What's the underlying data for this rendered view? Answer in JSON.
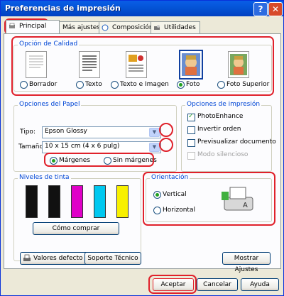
{
  "window": {
    "title": "Preferencias de impresión",
    "help_glyph": "?",
    "close_glyph": "✕"
  },
  "tabs": [
    {
      "label": "Principal",
      "icon": "printer-icon"
    },
    {
      "label": "Más ajustes",
      "icon": "options-icon"
    },
    {
      "label": "Composición",
      "icon": "layout-icon"
    },
    {
      "label": "Utilidades",
      "icon": "utilities-icon"
    }
  ],
  "quality": {
    "legend": "Opción de Calidad",
    "options": [
      {
        "label": "Borrador",
        "selected": false
      },
      {
        "label": "Texto",
        "selected": false
      },
      {
        "label": "Texto e Imagen",
        "selected": false
      },
      {
        "label": "Foto",
        "selected": true
      },
      {
        "label": "Foto Superior",
        "selected": false
      }
    ]
  },
  "paper": {
    "legend": "Opciones del Papel",
    "type_label": "Tipo:",
    "type_value": "Epson Glossy",
    "size_label": "Tamaño:",
    "size_value": "10 x 15 cm (4 x 6 pulg)",
    "margins_label": "Márgenes",
    "no_margins_label": "Sin márgenes",
    "margins_selected": true
  },
  "print_options": {
    "legend": "Opciones de impresión",
    "items": [
      {
        "label": "PhotoEnhance",
        "checked": true,
        "enabled": true
      },
      {
        "label": "Invertir orden",
        "checked": false,
        "enabled": true
      },
      {
        "label": "Previsualizar documento",
        "checked": false,
        "enabled": true
      },
      {
        "label": "Modo silencioso",
        "checked": false,
        "enabled": false
      }
    ]
  },
  "ink": {
    "legend": "Niveles de tinta",
    "cartridges": [
      {
        "color": "#111111"
      },
      {
        "color": "#111111"
      },
      {
        "color": "#e000c8"
      },
      {
        "color": "#00c8f0"
      },
      {
        "color": "#f8f000"
      }
    ],
    "buy_label": "Cómo comprar"
  },
  "orientation": {
    "legend": "Orientación",
    "vertical_label": "Vertical",
    "horizontal_label": "Horizontal",
    "vertical_selected": true
  },
  "footer": {
    "defaults_label": "Valores defecto",
    "support_label": "Soporte Técnico",
    "show_settings_label": "Mostrar Ajustes",
    "accept_label": "Aceptar",
    "cancel_label": "Cancelar",
    "help_label": "Ayuda"
  },
  "colors": {
    "highlight": "#e0212b",
    "legend_text": "#0046d5",
    "title_bar": "#0454d6"
  }
}
